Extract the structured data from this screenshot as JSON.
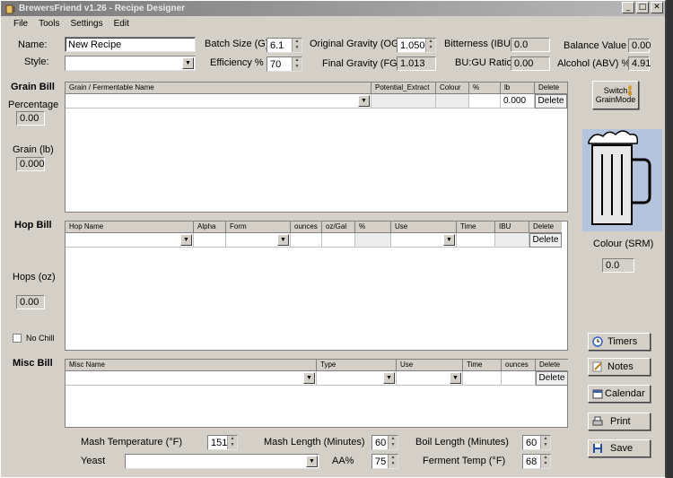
{
  "window": {
    "title": "BrewersFriend v1.26 - Recipe Designer"
  },
  "menu": [
    "File",
    "Tools",
    "Settings",
    "Edit"
  ],
  "recipe": {
    "name_label": "Name:",
    "name_value": "New Recipe",
    "style_label": "Style:",
    "style_value": "",
    "batch_size_label": "Batch Size (G)",
    "batch_size_value": "6.1",
    "efficiency_label": "Efficiency %",
    "efficiency_value": "70",
    "og_label": "Original Gravity (OG)",
    "og_value": "1.050",
    "fg_label": "Final Gravity (FG)",
    "fg_value": "1.013",
    "ibu_label": "Bitterness (IBU)",
    "ibu_value": "0.0",
    "bugu_label": "BU:GU Ratio",
    "bugu_value": "0.00",
    "balance_label": "Balance Value",
    "balance_value": "0.00",
    "abv_label": "Alcohol (ABV) %",
    "abv_value": "4.91"
  },
  "grain_bill": {
    "title": "Grain Bill",
    "percentage_label": "Percentage",
    "percentage_value": "0.00",
    "grain_label": "Grain (lb)",
    "grain_value": "0.000",
    "columns": [
      "Grain / Fermentable Name",
      "Potential_Extract",
      "Colour",
      "%",
      "lb",
      "Delete"
    ],
    "row": {
      "lb": "0.000",
      "delete": "Delete"
    }
  },
  "hop_bill": {
    "title": "Hop Bill",
    "hops_label": "Hops (oz)",
    "hops_value": "0.00",
    "no_chill_label": "No Chill",
    "columns": [
      "Hop Name",
      "Alpha",
      "Form",
      "ounces",
      "oz/Gal",
      "%",
      "Use",
      "Time",
      "IBU",
      "Delete"
    ],
    "row": {
      "delete": "Delete"
    }
  },
  "misc_bill": {
    "title": "Misc Bill",
    "columns": [
      "Misc Name",
      "Type",
      "Use",
      "Time",
      "ounces",
      "Delete"
    ],
    "row": {
      "delete": "Delete"
    }
  },
  "side": {
    "switch_line1": "Switch",
    "switch_line2": "GrainMode",
    "colour_label": "Colour (SRM)",
    "colour_value": "0.0",
    "timers": "Timers",
    "notes": "Notes",
    "calendar": "Calendar",
    "print": "Print",
    "save": "Save"
  },
  "bottom": {
    "mash_temp_label": "Mash Temperature (°F)",
    "mash_temp_value": "151",
    "mash_length_label": "Mash Length (Minutes)",
    "mash_length_value": "60",
    "boil_length_label": "Boil Length (Minutes)",
    "boil_length_value": "60",
    "yeast_label": "Yeast",
    "yeast_value": "",
    "aa_label": "AA%",
    "aa_value": "75",
    "ferment_temp_label": "Ferment Temp (°F)",
    "ferment_temp_value": "68"
  }
}
